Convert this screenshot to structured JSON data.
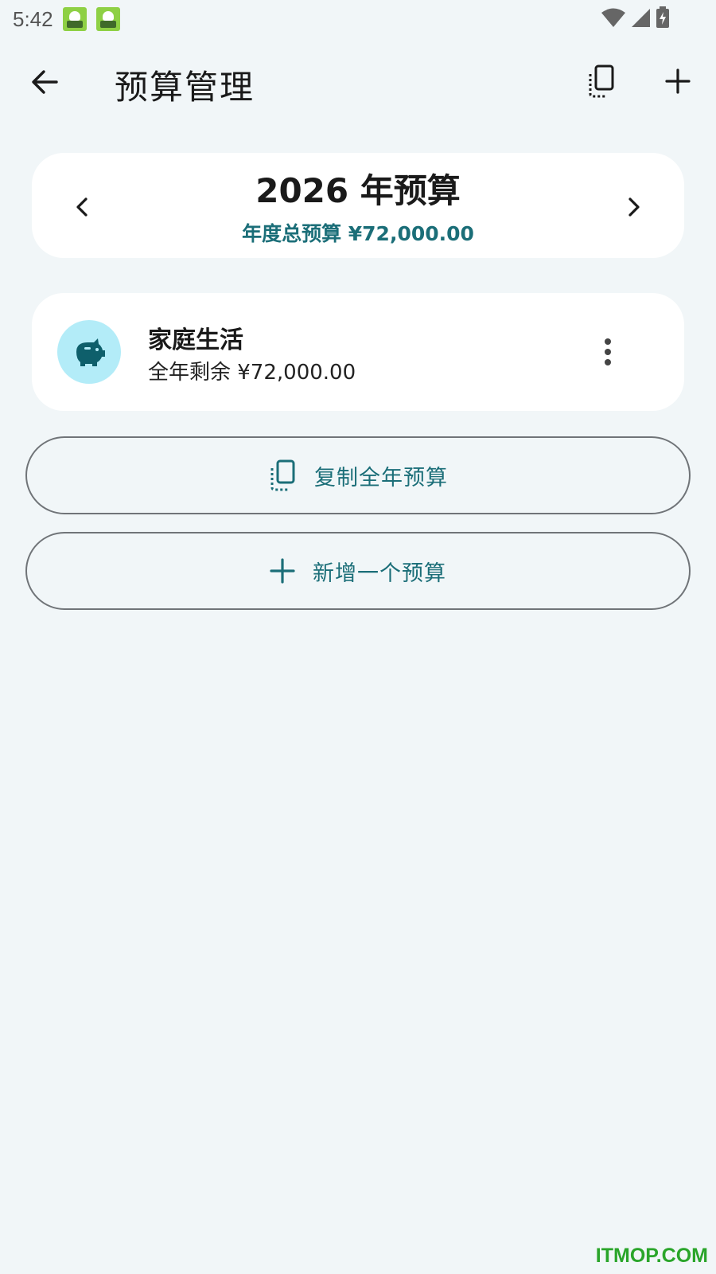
{
  "status_bar": {
    "time": "5:42",
    "icons": [
      "app-notification-icon",
      "app-notification-icon",
      "wifi-icon",
      "signal-icon",
      "battery-charging-icon"
    ]
  },
  "toolbar": {
    "title": "预算管理",
    "back_icon": "arrow-back-icon",
    "copy_icon": "copy-icon",
    "add_icon": "plus-icon"
  },
  "year_card": {
    "title": "2026 年预算",
    "total": "年度总预算 ¥72,000.00",
    "prev_icon": "chevron-left-icon",
    "next_icon": "chevron-right-icon"
  },
  "budgets": [
    {
      "name": "家庭生活",
      "remaining": "全年剩余 ¥72,000.00",
      "icon": "piggy-bank-icon",
      "menu_icon": "more-vert-icon"
    }
  ],
  "actions": {
    "copy_year_label": "复制全年预算",
    "add_budget_label": "新增一个预算"
  },
  "watermark": "ITMOP.COM",
  "colors": {
    "background": "#f1f6f8",
    "card": "#ffffff",
    "accent": "#1b6e78",
    "avatar_bg": "#b3ecf8",
    "watermark": "#2aa52a"
  }
}
